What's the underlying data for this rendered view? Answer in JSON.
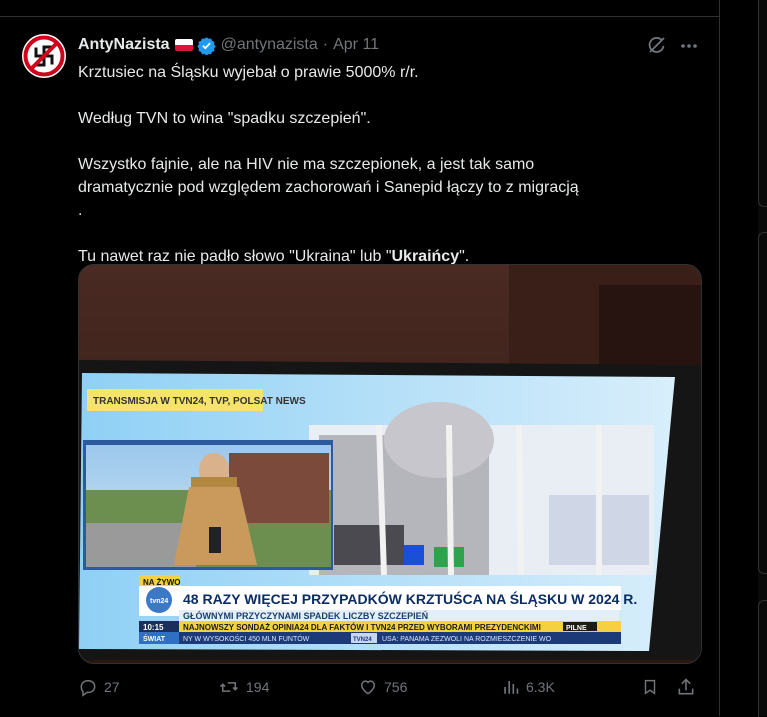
{
  "tweet": {
    "author_name": "AntyNazista",
    "handle": "@antynazista",
    "separator": "·",
    "date": "Apr 11",
    "text_lines": [
      "Krztusiec na Śląsku wyjebał o prawie 5000% r/r.",
      "Według TVN to wina \"spadku szczepień\".",
      "Wszystko fajnie, ale na HIV nie ma szczepionek, a jest tak samo",
      "dramatycznie pod względem zachorowań i Sanepid łączy to z migracją",
      "Tu nawet raz nie padło słowo \"Ukraina\" lub \"",
      "Ukraińcy",
      "\"."
    ],
    "icons": {
      "avatar": "crossed-swastika-avatar",
      "author_flag": "poland-flag-icon",
      "verified": "verified-badge-icon",
      "grok": "grok-icon",
      "more": "more-icon",
      "inline_flag": "ukraine-flag-icon"
    }
  },
  "media": {
    "tv_screen": {
      "channel_banner": "TRANSMISJA W TVN24, TVP, POLSAT NEWS",
      "live_badge": "NA ŻYWO",
      "headline": "48 RAZY WIĘCEJ PRZYPADKÓW KRZTUŚCA NA ŚLĄSKU W 2024 R.",
      "subheadline": "GŁÓWNYMI PRZYCZYNAMI SPADEK LICZBY SZCZEPIEŃ",
      "time": "10:15",
      "ticker_1": "NAJNOWSZY SONDAŻ OPINIA24 DLA FAKTÓW I TVN24 PRZED WYBORAMI PREZYDENCKIMI",
      "ticker_1_badge": "PILNE",
      "world_badge": "ŚWIAT",
      "ticker_2a": "NY W WYSOKOŚCI 450 MLN FUNTÓW",
      "ticker_2_logo": "TVN24",
      "ticker_2b": "USA: PANAMA ZEZWOLI NA ROZMIESZCZENIE WO",
      "logo": "tvn24"
    }
  },
  "actions": {
    "replies": "27",
    "reposts": "194",
    "likes": "756",
    "views": "6.3K",
    "icons": [
      "reply-icon",
      "repost-icon",
      "like-icon",
      "views-icon",
      "bookmark-icon",
      "share-icon"
    ]
  },
  "colors": {
    "background": "#000000",
    "text": "#e7e9ea",
    "muted": "#71767b",
    "verified": "#1d9bf0",
    "divider": "#2f3336"
  }
}
